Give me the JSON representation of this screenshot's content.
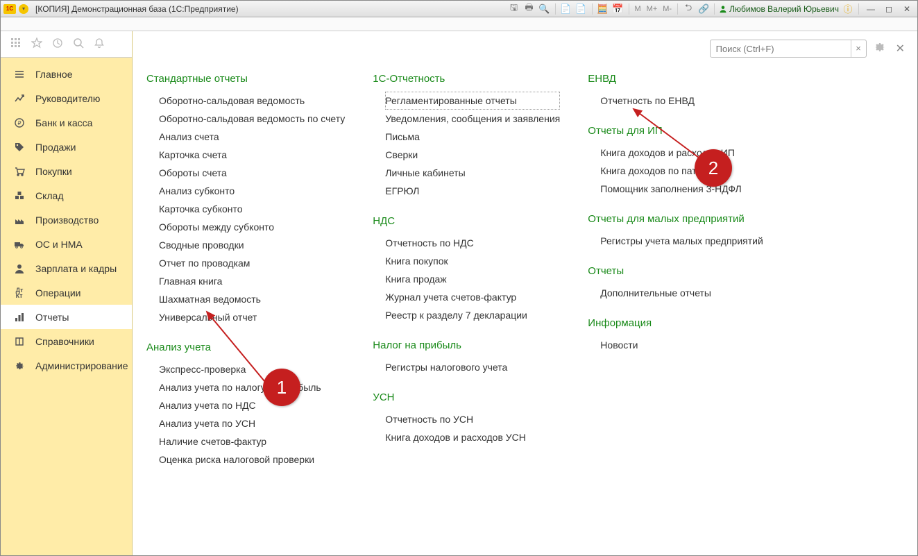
{
  "window": {
    "title": "[КОПИЯ] Демонстрационная база  (1С:Предприятие)",
    "user": "Любимов Валерий Юрьевич",
    "m_labels": [
      "M",
      "M+",
      "M-"
    ]
  },
  "search": {
    "placeholder": "Поиск (Ctrl+F)"
  },
  "nav": {
    "items": [
      {
        "label": "Главное",
        "icon": "menu-icon"
      },
      {
        "label": "Руководителю",
        "icon": "trend-icon"
      },
      {
        "label": "Банк и касса",
        "icon": "ruble-icon"
      },
      {
        "label": "Продажи",
        "icon": "tag-icon"
      },
      {
        "label": "Покупки",
        "icon": "cart-icon"
      },
      {
        "label": "Склад",
        "icon": "boxes-icon"
      },
      {
        "label": "Производство",
        "icon": "factory-icon"
      },
      {
        "label": "ОС и НМА",
        "icon": "truck-icon"
      },
      {
        "label": "Зарплата и кадры",
        "icon": "person-icon"
      },
      {
        "label": "Операции",
        "icon": "dtkt-icon"
      },
      {
        "label": "Отчеты",
        "icon": "chart-icon"
      },
      {
        "label": "Справочники",
        "icon": "book-icon"
      },
      {
        "label": "Администрирование",
        "icon": "gear-icon"
      }
    ],
    "active_index": 10
  },
  "columns": [
    {
      "sections": [
        {
          "title": "Стандартные отчеты",
          "items": [
            "Оборотно-сальдовая ведомость",
            "Оборотно-сальдовая ведомость по счету",
            "Анализ счета",
            "Карточка счета",
            "Обороты счета",
            "Анализ субконто",
            "Карточка субконто",
            "Обороты между субконто",
            "Сводные проводки",
            "Отчет по проводкам",
            "Главная книга",
            "Шахматная ведомость",
            "Универсальный отчет"
          ]
        },
        {
          "title": "Анализ учета",
          "items": [
            "Экспресс-проверка",
            "Анализ учета по налогу на прибыль",
            "Анализ учета по НДС",
            "Анализ учета по УСН",
            "Наличие счетов-фактур",
            "Оценка риска налоговой проверки"
          ]
        }
      ]
    },
    {
      "sections": [
        {
          "title": "1С-Отчетность",
          "items": [
            "Регламентированные отчеты",
            "Уведомления, сообщения и заявления",
            "Письма",
            "Сверки",
            "Личные кабинеты",
            "ЕГРЮЛ"
          ],
          "highlight_index": 0
        },
        {
          "title": "НДС",
          "items": [
            "Отчетность по НДС",
            "Книга покупок",
            "Книга продаж",
            "Журнал учета счетов-фактур",
            "Реестр к разделу 7 декларации"
          ]
        },
        {
          "title": "Налог на прибыль",
          "items": [
            "Регистры налогового учета"
          ]
        },
        {
          "title": "УСН",
          "items": [
            "Отчетность по УСН",
            "Книга доходов и расходов УСН"
          ]
        }
      ]
    },
    {
      "sections": [
        {
          "title": "ЕНВД",
          "items": [
            "Отчетность по ЕНВД"
          ]
        },
        {
          "title": "Отчеты для ИП",
          "items": [
            "Книга доходов и расходов ИП",
            "Книга доходов по патенту",
            "Помощник заполнения 3-НДФЛ"
          ]
        },
        {
          "title": "Отчеты для малых предприятий",
          "items": [
            "Регистры учета малых предприятий"
          ]
        },
        {
          "title": "Отчеты",
          "items": [
            "Дополнительные отчеты"
          ]
        },
        {
          "title": "Информация",
          "items": [
            "Новости"
          ]
        }
      ]
    }
  ],
  "callouts": {
    "one": "1",
    "two": "2"
  }
}
